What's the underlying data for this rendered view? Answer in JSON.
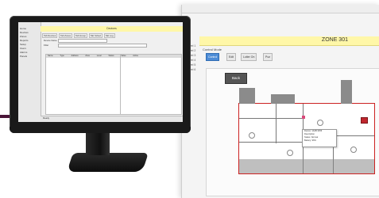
{
  "colors": {
    "accent": "#4a1538",
    "zone_bar": "#fff7a8",
    "alarm_red": "#c0262e",
    "toolbar_blue": "#4d8cd6"
  },
  "floorplan_window": {
    "zone_title": "ZONE 301",
    "side_levels": [
      "Level 1",
      "Level 2",
      "Level 3",
      "Level 4",
      "Level 5",
      "Level 6"
    ],
    "toolbar_label": "Control Mode",
    "toolbar_buttons": [
      "Control",
      "Edit",
      "Loiter On",
      "Poz"
    ],
    "back_button": "Back",
    "tooltip_lines": [
      "Device: 1A2B 3456",
      "Description",
      "Status: Normal",
      "Battery: 96%"
    ]
  },
  "monitor_app": {
    "title": "Devices",
    "sidebar_items": [
      "Home",
      "Devices",
      "Zones",
      "Reports",
      "Setup",
      "Users",
      "Alarms",
      "Panels"
    ],
    "tabs": [
      "Tab Devices",
      "Tab Zones",
      "Tab Group",
      "Tab Sched",
      "Tab Log"
    ],
    "form_labels": [
      "Device Name",
      "Filter"
    ],
    "grid_columns": [
      "Name",
      "Type",
      "Address",
      "Zone",
      "Level",
      "Status",
      "Value",
      "Active"
    ],
    "status_text": "Ready"
  }
}
